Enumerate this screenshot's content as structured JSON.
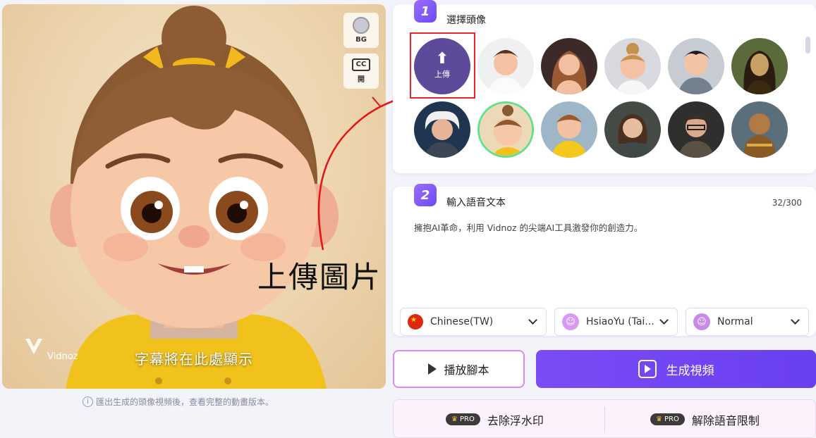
{
  "preview": {
    "bg_label": "BG",
    "cc_label": "CC",
    "cc_state": "開",
    "subtitle": "字幕將在此處顯示",
    "watermark": "Vidnoz",
    "note": "匯出生成的頭像視頻後，查看完整的動畫版本。",
    "annotation": "上傳圖片"
  },
  "step1": {
    "number": "1",
    "title": "選擇頭像",
    "upload_label": "上傳",
    "avatars": [
      {
        "name": "avatar-young-man"
      },
      {
        "name": "avatar-woman-long-hair"
      },
      {
        "name": "avatar-girl-blonde"
      },
      {
        "name": "avatar-boy-cartoon"
      },
      {
        "name": "avatar-mona-lisa"
      },
      {
        "name": "avatar-einstein"
      },
      {
        "name": "avatar-girl-bun"
      },
      {
        "name": "avatar-boy-yellow"
      },
      {
        "name": "avatar-woman-realistic"
      },
      {
        "name": "avatar-man-glasses"
      },
      {
        "name": "avatar-monkey-king"
      }
    ]
  },
  "step2": {
    "number": "2",
    "title": "輸入語音文本",
    "count": "32/300",
    "text": "擁抱AI革命，利用 Vidnoz 的尖端AI工具激發你的創造力。",
    "language": "Chinese(TW)",
    "voice": "HsiaoYu (Tai...",
    "style": "Normal"
  },
  "actions": {
    "play": "播放腳本",
    "generate": "生成視頻"
  },
  "pro": {
    "badge": "PRO",
    "remove_watermark": "去除浮水印",
    "remove_voice_limit": "解除語音限制"
  },
  "colors": {
    "accent": "#6d43f2",
    "upload_bg": "#5d4a9a",
    "highlight_frame": "#e6242b"
  }
}
